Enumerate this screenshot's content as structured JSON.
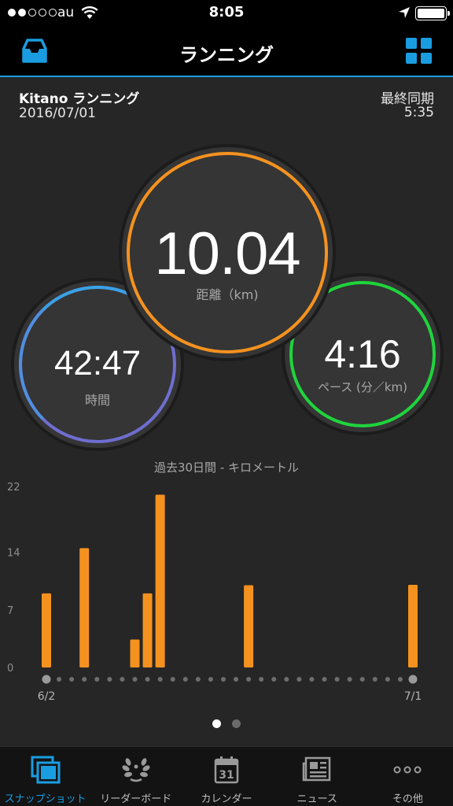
{
  "status_bar": {
    "carrier": "au",
    "time": "8:05",
    "signal_bars": 2,
    "battery_level": 1.0
  },
  "nav": {
    "title": "ランニング",
    "left_icon": "inbox-icon",
    "right_icon": "grid-icon",
    "accent_color": "#1a9de0"
  },
  "activity": {
    "name": "Kitano ランニング",
    "date": "2016/07/01",
    "sync_label": "最終同期",
    "sync_time": "5:35"
  },
  "stats": {
    "distance": {
      "value": "10.04",
      "label": "距離（km)",
      "color": "#f5921f"
    },
    "time": {
      "value": "42:47",
      "label": "時間",
      "color": "#6e6ed0"
    },
    "pace": {
      "value": "4:16",
      "label": "ペース (分／km)",
      "color": "#1fd43c"
    }
  },
  "chart_data": {
    "type": "bar",
    "title": "過去30日間 - キロメートル",
    "x_start_label": "6/2",
    "x_end_label": "7/1",
    "y_ticks": [
      "0",
      "7",
      "14",
      "22"
    ],
    "ylim": [
      0,
      22
    ],
    "bar_color": "#f5921f",
    "day_count": 30,
    "bars": [
      {
        "day": 0,
        "value": 9.0
      },
      {
        "day": 3,
        "value": 14.5
      },
      {
        "day": 7,
        "value": 3.4
      },
      {
        "day": 8,
        "value": 9.0
      },
      {
        "day": 9,
        "value": 21.0
      },
      {
        "day": 16,
        "value": 10.0
      },
      {
        "day": 29,
        "value": 10.04
      }
    ]
  },
  "pager": {
    "page_count": 2,
    "active_page": 0
  },
  "tabs": [
    {
      "label": "スナップショット",
      "icon": "snapshot-icon",
      "active": true
    },
    {
      "label": "リーダーボード",
      "icon": "laurel-icon",
      "active": false
    },
    {
      "label": "カレンダー",
      "icon": "calendar-icon",
      "calendar_day": "31",
      "active": false
    },
    {
      "label": "ニュース",
      "icon": "news-icon",
      "active": false
    },
    {
      "label": "その他",
      "icon": "more-icon",
      "active": false
    }
  ]
}
